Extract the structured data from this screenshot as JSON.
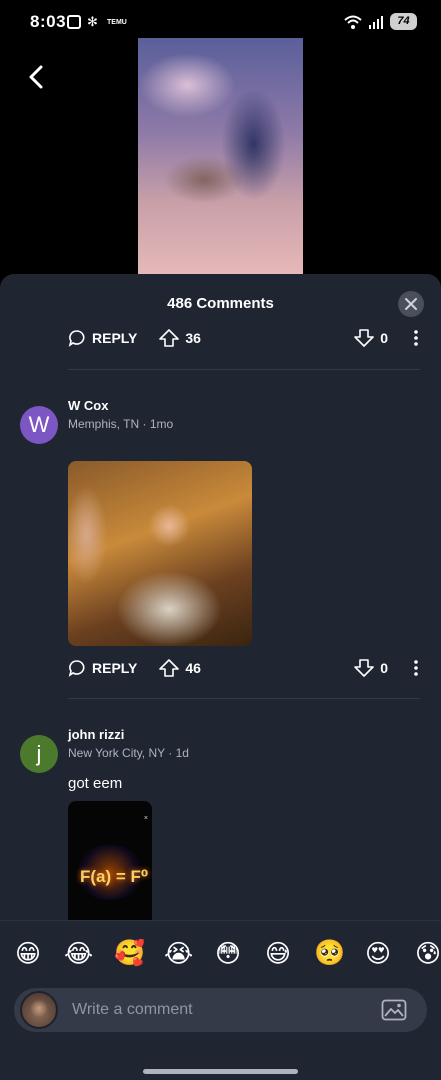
{
  "status_bar": {
    "time": "8:03",
    "temu_label": "TEMU",
    "battery": "74"
  },
  "sheet": {
    "title": "486 Comments"
  },
  "comments": [
    {
      "reply_label": "REPLY",
      "upvotes": "36",
      "downvotes": "0"
    },
    {
      "avatar_letter": "W",
      "author": "W Cox",
      "location": "Memphis, TN",
      "age": "1mo",
      "reply_label": "REPLY",
      "upvotes": "46",
      "downvotes": "0"
    },
    {
      "avatar_letter": "j",
      "author": "john rizzi",
      "location": "New York City, NY",
      "age": "1d",
      "text": "got eem",
      "gif_text": "F(a) = F⁰"
    }
  ],
  "emoji_bar": [
    "😁",
    "😂",
    "🥰",
    "😭",
    "😳",
    "😅",
    "🥺",
    "😍",
    "😰"
  ],
  "composer": {
    "placeholder": "Write a comment"
  },
  "colors": {
    "sheet_bg": "#202532",
    "avatar_w": "#7c56c2",
    "avatar_j": "#4c7a2c"
  },
  "icons": {
    "back": "chevron-left-icon",
    "close": "close-icon",
    "reply": "speech-bubble-icon",
    "upvote": "arrow-up-outline-icon",
    "downvote": "arrow-down-outline-icon",
    "more": "vertical-dots-icon",
    "image": "image-icon"
  }
}
